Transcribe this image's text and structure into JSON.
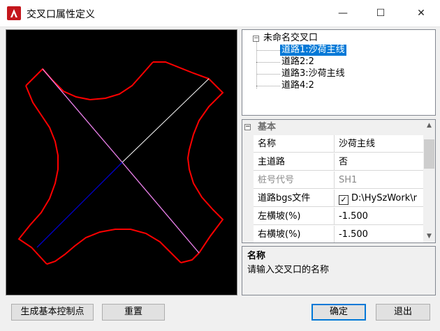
{
  "window": {
    "title": "交叉口属性定义",
    "minimize_glyph": "—",
    "maximize_glyph": "☐",
    "close_glyph": "✕",
    "icon": "autocad-logo-icon"
  },
  "tree": {
    "toggle_glyph": "⊟",
    "root": "未命名交叉口",
    "items": [
      {
        "label": "道路1:沙荷主线",
        "selected": true
      },
      {
        "label": "道路2:2",
        "selected": false
      },
      {
        "label": "道路3:沙荷主线",
        "selected": false
      },
      {
        "label": "道路4:2",
        "selected": false
      }
    ]
  },
  "properties": {
    "category": {
      "toggle_glyph": "⊟",
      "label": "基本"
    },
    "rows": [
      {
        "name": "名称",
        "value": "沙荷主线",
        "disabled": false
      },
      {
        "name": "主道路",
        "value": "否",
        "disabled": false
      },
      {
        "name": "桩号代号",
        "value": "SH1",
        "disabled": true
      },
      {
        "name": "道路bgs文件",
        "value": "D:\\HySzWork\\r",
        "disabled": false,
        "checked": true
      },
      {
        "name": "左横坡(%)",
        "value": "-1.500",
        "disabled": false
      },
      {
        "name": "右横坡(%)",
        "value": "-1.500",
        "disabled": false
      }
    ],
    "scroll_up_glyph": "▲",
    "scroll_down_glyph": "▼"
  },
  "description": {
    "title": "名称",
    "text": "请输入交叉口的名称"
  },
  "buttons": {
    "generate": "生成基本控制点",
    "reset": "重置",
    "ok": "确定",
    "exit": "退出"
  },
  "colors": {
    "selection": "#0078d7",
    "curb": "#ff0000",
    "road1": "#ee82ee",
    "road2": "#ffffff",
    "road3": "#0000cd"
  }
}
